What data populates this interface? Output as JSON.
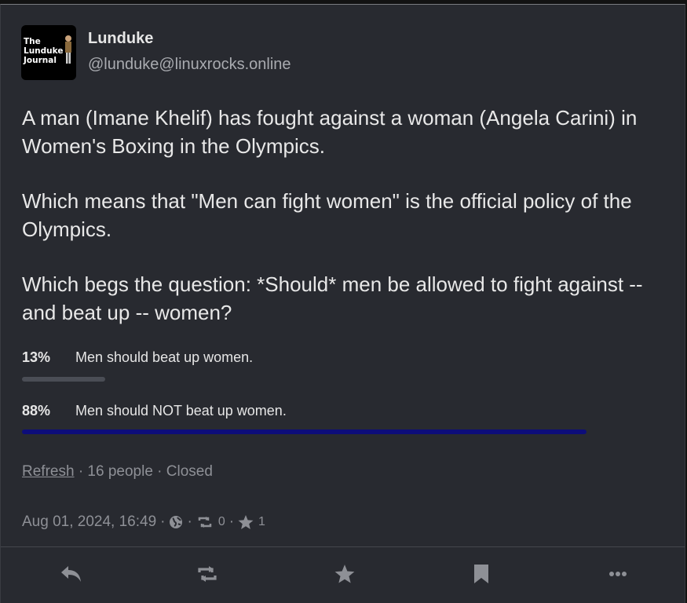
{
  "author": {
    "display_name": "Lunduke",
    "handle": "@lunduke@linuxrocks.online",
    "avatar_text": "The Lunduke Journal"
  },
  "post": {
    "paragraphs": [
      "A man (Imane Khelif) has fought against a woman (Angela Carini) in Women's Boxing in the Olympics.",
      "Which means that \"Men can fight women\" is the official policy of the Olympics.",
      "Which begs the question: *Should* men be allowed to fight against -- and beat up -- women?"
    ]
  },
  "poll": {
    "options": [
      {
        "percent_label": "13%",
        "text": "Men should beat up women.",
        "fraction": 0.13,
        "bar_color": "#4a4d55"
      },
      {
        "percent_label": "88%",
        "text": "Men should NOT beat up women.",
        "fraction": 0.88,
        "bar_color": "#0d0d7a"
      }
    ],
    "refresh_label": "Refresh",
    "voters": "16 people",
    "status": "Closed"
  },
  "meta": {
    "timestamp": "Aug 01, 2024, 16:49",
    "visibility_icon": "globe-icon",
    "boost_count": "0",
    "favourite_count": "1"
  },
  "actions": [
    {
      "name": "reply-button",
      "icon": "reply-icon"
    },
    {
      "name": "boost-button",
      "icon": "boost-icon"
    },
    {
      "name": "favourite-button",
      "icon": "star-icon"
    },
    {
      "name": "bookmark-button",
      "icon": "bookmark-icon"
    },
    {
      "name": "more-button",
      "icon": "ellipsis-icon"
    }
  ],
  "colors": {
    "card_bg": "#282a30",
    "muted_text": "#8e9096",
    "icon_color": "#8e9096"
  }
}
